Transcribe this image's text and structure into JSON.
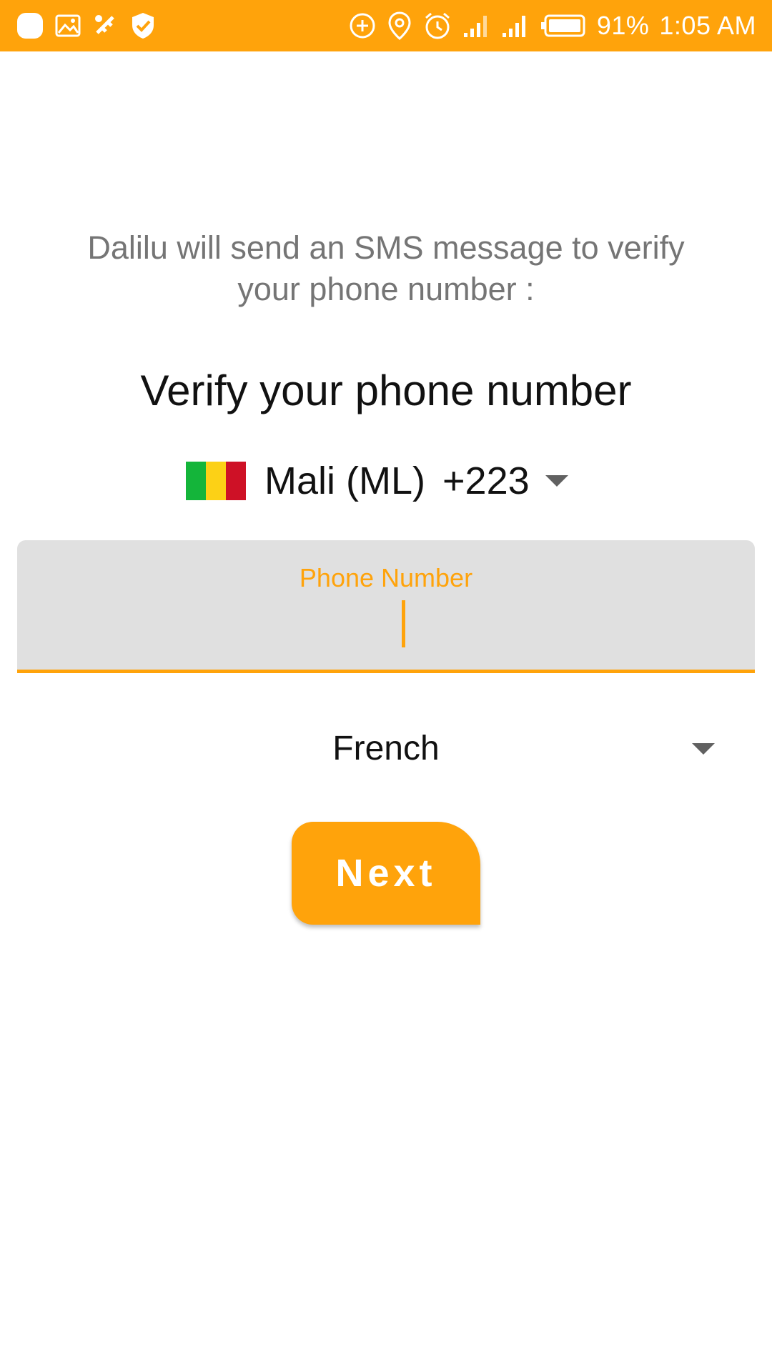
{
  "status_bar": {
    "battery": "91%",
    "time": "1:05 AM",
    "left_icons": [
      "app-notification-icon",
      "image-icon",
      "fake-gps-icon",
      "shield-check-icon"
    ],
    "right_icons": [
      "data-saver-icon",
      "location-icon",
      "alarm-icon",
      "signal-icon",
      "signal-icon",
      "battery-icon"
    ],
    "color": "#FFA30B"
  },
  "intro_text": "Dalilu will send an SMS message to verify your phone number :",
  "heading": "Verify your phone number",
  "country": {
    "name": "Mali (ML)",
    "code": "+223",
    "flag_colors": [
      "#14B53A",
      "#FCD116",
      "#CE1126"
    ]
  },
  "phone_field": {
    "label": "Phone Number",
    "value": ""
  },
  "language": {
    "selected": "French"
  },
  "next_button": {
    "label": "Next"
  },
  "colors": {
    "accent": "#FFA30B"
  }
}
